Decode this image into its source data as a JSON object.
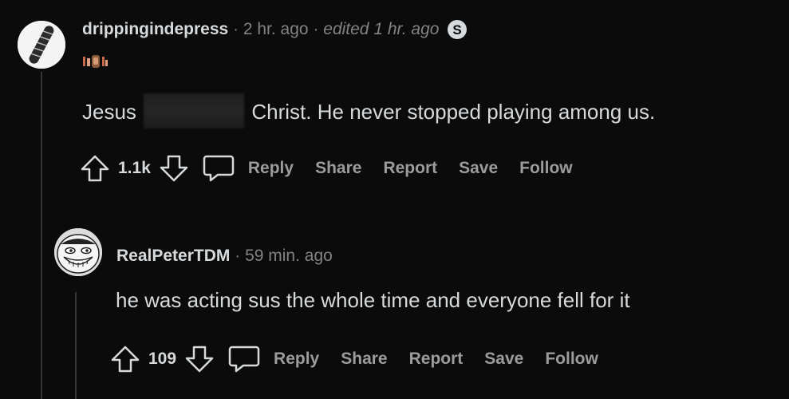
{
  "comments": [
    {
      "username": "drippingindepress",
      "separator": "·",
      "time": "2 hr. ago",
      "edited": "edited 1 hr. ago",
      "body_before": "Jesus",
      "body_after": "Christ. He never stopped playing among us.",
      "votes": "1.1k",
      "actions": {
        "reply": "Reply",
        "share": "Share",
        "report": "Report",
        "save": "Save",
        "follow": "Follow"
      },
      "icons": [
        "arrow-up-icon",
        "arrow-down-icon",
        "chat-bubble-icon",
        "s-badge-icon",
        "flair-emoji-icon"
      ]
    },
    {
      "username": "RealPeterTDM",
      "separator": "·",
      "time": "59 min. ago",
      "body": "he was acting sus the whole time and everyone fell for it",
      "votes": "109",
      "actions": {
        "reply": "Reply",
        "share": "Share",
        "report": "Report",
        "save": "Save",
        "follow": "Follow"
      },
      "icons": [
        "arrow-up-icon",
        "arrow-down-icon",
        "chat-bubble-icon"
      ]
    }
  ],
  "colors": {
    "background": "#0b0b0b",
    "text": "#d7dadc",
    "muted": "#818384",
    "action": "#9a9c9e",
    "threadline": "#343536"
  }
}
